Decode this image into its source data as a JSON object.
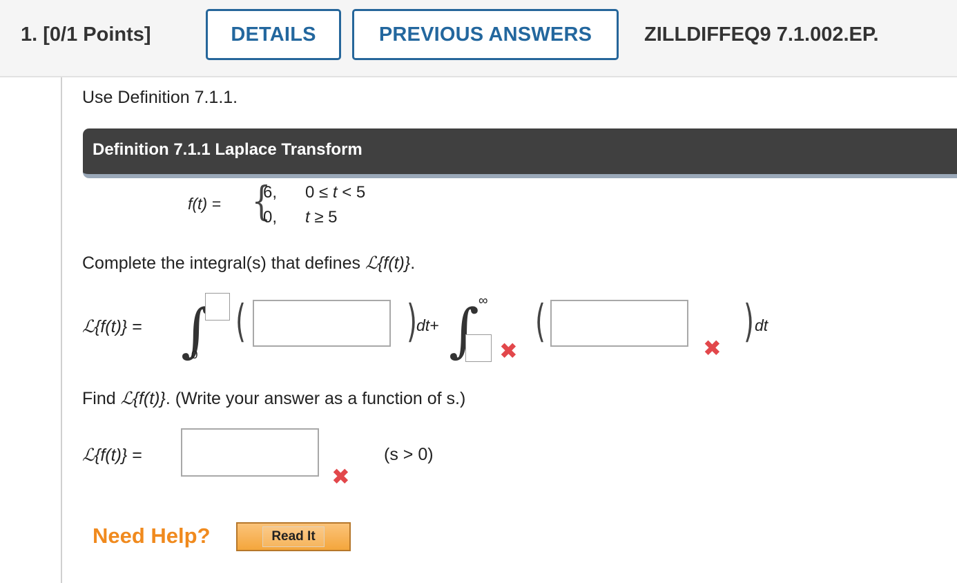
{
  "header": {
    "question_label": "1.  [0/1 Points]",
    "details_label": "DETAILS",
    "previous_answers_label": "PREVIOUS ANSWERS",
    "problem_code": "ZILLDIFFEQ9 7.1.002.EP."
  },
  "body": {
    "instruction": "Use Definition 7.1.1.",
    "definition_title": "Definition 7.1.1 Laplace Transform",
    "function": {
      "lhs": "f(t)  =",
      "case1_value": "6,",
      "case1_condition_left": "0 ≤ ",
      "case1_condition_var": "t",
      "case1_condition_right": " < 5",
      "case2_value": "0,",
      "case2_condition_var": "t",
      "case2_condition_right": " ≥ 5"
    },
    "prompt1_pre": "Complete the integral(s) that defines ",
    "laplace_symbol": "ℒ",
    "laplace_arg": "{f(t)}",
    "prompt1_post": ".",
    "integral_lhs_eq": " =",
    "lower_limit_1": "0",
    "dt_plus": "dt+",
    "upper_limit_2": "∞",
    "dt": "dt",
    "prompt2_pre": "Find ",
    "prompt2_post": ". (Write your answer as a function of s.)",
    "answer_lhs_eq": " =",
    "condition": "(s > 0)"
  },
  "help": {
    "need_help_label": "Need Help?",
    "read_it_label": "Read It"
  },
  "status": {
    "incorrect_icon": "x-mark-icon",
    "incorrect_color": "#e2474b",
    "accent_color": "#26669a",
    "help_color": "#f08a1e"
  }
}
